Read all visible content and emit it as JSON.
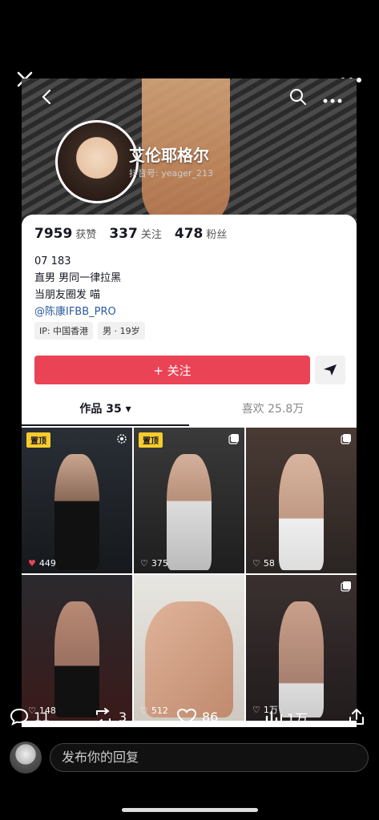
{
  "header": {
    "nickname": "艾伦耶格尔",
    "douyin_id": "抖音号: yeager_213"
  },
  "stats": [
    {
      "num": "7959",
      "label": "获赞"
    },
    {
      "num": "337",
      "label": "关注"
    },
    {
      "num": "478",
      "label": "粉丝"
    }
  ],
  "bio": {
    "line1": "07 183",
    "line2": "直男 男同一律拉黑",
    "line3": "当朋友圈发 喵",
    "mention": "@陈康IFBB_PRO"
  },
  "tags": [
    "IP: 中国香港",
    "男 · 19岁"
  ],
  "follow_label": "+ 关注",
  "tabs": {
    "works": "作品 35",
    "likes": "喜欢 25.8万"
  },
  "grid": [
    {
      "pin": "置顶",
      "likes": "449",
      "liked": true
    },
    {
      "pin": "置顶",
      "likes": "375",
      "liked": false
    },
    {
      "pin": "",
      "likes": "58",
      "liked": false
    },
    {
      "pin": "",
      "likes": "148",
      "liked": false
    },
    {
      "pin": "",
      "likes": "512",
      "liked": false
    },
    {
      "pin": "",
      "likes": "1万",
      "liked": false
    }
  ],
  "overlay": {
    "comments": "11",
    "reposts": "3",
    "likes": "86",
    "views": "1万"
  },
  "reply_placeholder": "发布你的回复",
  "colors": {
    "follow_red": "#ea4355",
    "pin_yellow": "#f8cb2e",
    "mention_blue": "#2c5a9e"
  }
}
